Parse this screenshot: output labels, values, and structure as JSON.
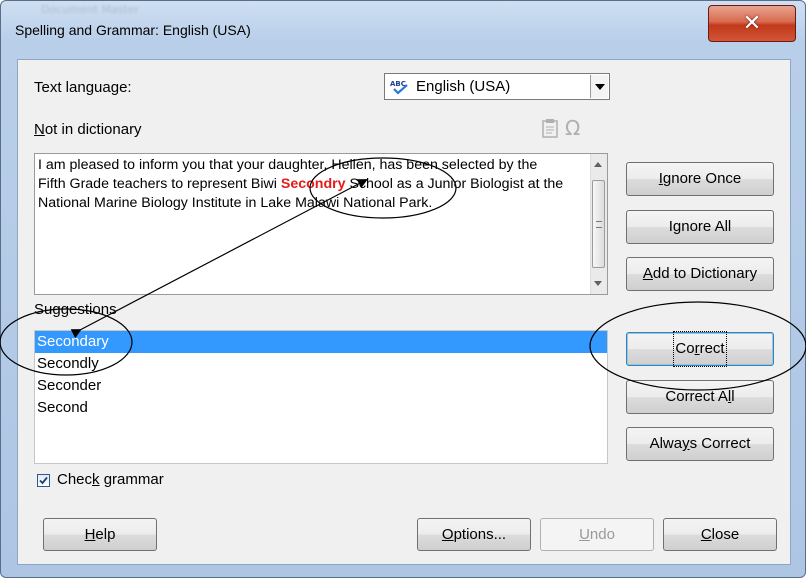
{
  "window": {
    "title": "Spelling and Grammar: English (USA)",
    "background_title": "Document Master"
  },
  "language": {
    "label_prefix": "Text langua",
    "label_ul": "g",
    "label_suffix": "e:",
    "selected": "English (USA)"
  },
  "dictionary": {
    "label_ul": "N",
    "label_rest": "ot in dictionary",
    "text_before": "I am pleased to inform you that your daughter, Hellen, has been selected by the Fifth Grade teachers to represent Biwi ",
    "misspelled_word": "Secondry",
    "text_after": " School as a Junior Biologist at the National Marine Biology Institute in Lake Malawi National Park."
  },
  "suggestions": {
    "label_prefix": "Su",
    "label_ul": "g",
    "label_suffix": "gestions",
    "items": [
      "Secondary",
      "Secondly",
      "Seconder",
      "Second"
    ],
    "selected_index": 0
  },
  "buttons": {
    "ignore_once": {
      "ul": "I",
      "rest": "gnore Once"
    },
    "ignore_all": {
      "pre": "I",
      "ul": "g",
      "rest": "nore All"
    },
    "add_to_dictionary": {
      "ul": "A",
      "rest": "dd to Dictionary"
    },
    "correct": {
      "pre": "Co",
      "ul": "r",
      "rest": "rect"
    },
    "correct_all": {
      "pre": "Correct A",
      "ul": "l",
      "rest": "l"
    },
    "always_correct": {
      "pre": "Alwa",
      "ul": "y",
      "rest": "s Correct"
    },
    "help": {
      "ul": "H",
      "rest": "elp"
    },
    "options": {
      "ul": "O",
      "rest": "ptions..."
    },
    "undo": {
      "ul": "U",
      "rest": "ndo"
    },
    "close": {
      "ul": "C",
      "rest": "lose"
    }
  },
  "grammar": {
    "label_pre": "Chec",
    "label_ul": "k",
    "label_rest": " grammar",
    "checked": true
  },
  "icons": [
    "close-icon",
    "spellcheck-flag-icon",
    "dropdown-arrow-icon",
    "clipboard-icon",
    "omega-icon",
    "checkmark-icon"
  ],
  "colors": {
    "misspelled": "#e31b1b",
    "selection": "#3399ff",
    "close_button": "#c1391b"
  }
}
